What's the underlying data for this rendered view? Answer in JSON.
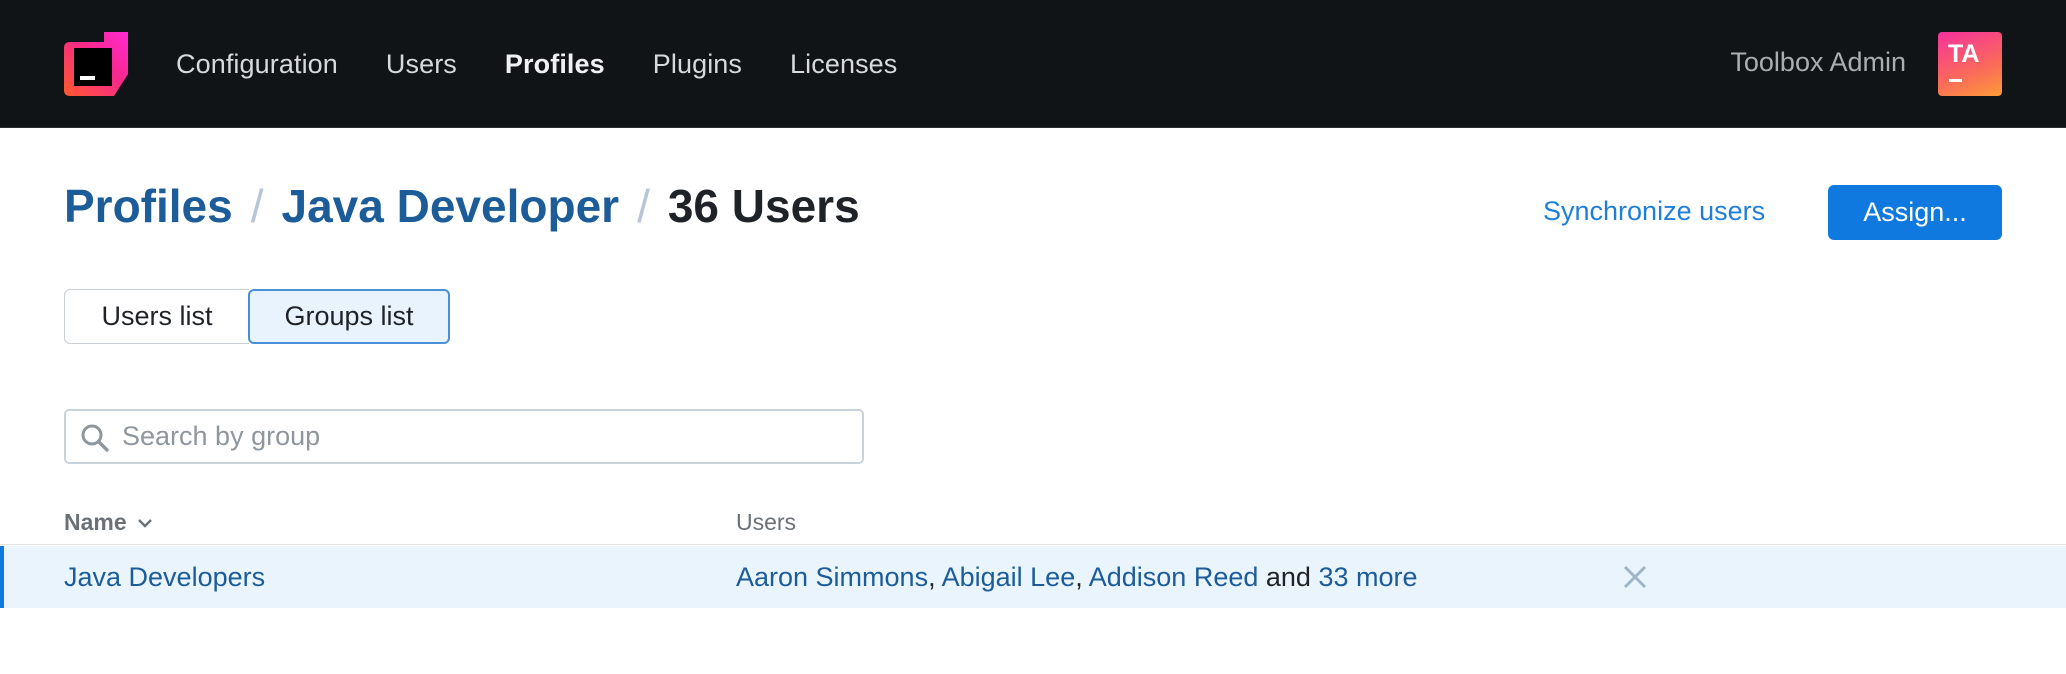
{
  "colors": {
    "topbar_bg": "#111416",
    "accent": "#1079e0",
    "link": "#1b5c99",
    "row_highlight": "#eaf4fd"
  },
  "nav": {
    "items": [
      {
        "label": "Configuration",
        "active": false
      },
      {
        "label": "Users",
        "active": false
      },
      {
        "label": "Profiles",
        "active": true
      },
      {
        "label": "Plugins",
        "active": false
      },
      {
        "label": "Licenses",
        "active": false
      }
    ],
    "user_name": "Toolbox Admin",
    "avatar_initials": "TA"
  },
  "breadcrumb": {
    "root": "Profiles",
    "separator": "/",
    "profile": "Java Developer",
    "current": "36 Users"
  },
  "actions": {
    "sync_label": "Synchronize users",
    "assign_label": "Assign..."
  },
  "view_toggle": {
    "users_list": "Users list",
    "groups_list": "Groups list",
    "selected": "Groups list"
  },
  "search": {
    "placeholder": "Search by group",
    "value": ""
  },
  "table": {
    "columns": {
      "name": "Name",
      "users": "Users"
    },
    "sort_icon": "chevron-down-icon",
    "rows": [
      {
        "name": "Java Developers",
        "users": [
          "Aaron Simmons",
          "Abigail Lee",
          "Addison Reed"
        ],
        "separator": ",",
        "and_text": "and",
        "more_text": "33 more",
        "remove_icon": "close-icon"
      }
    ]
  }
}
